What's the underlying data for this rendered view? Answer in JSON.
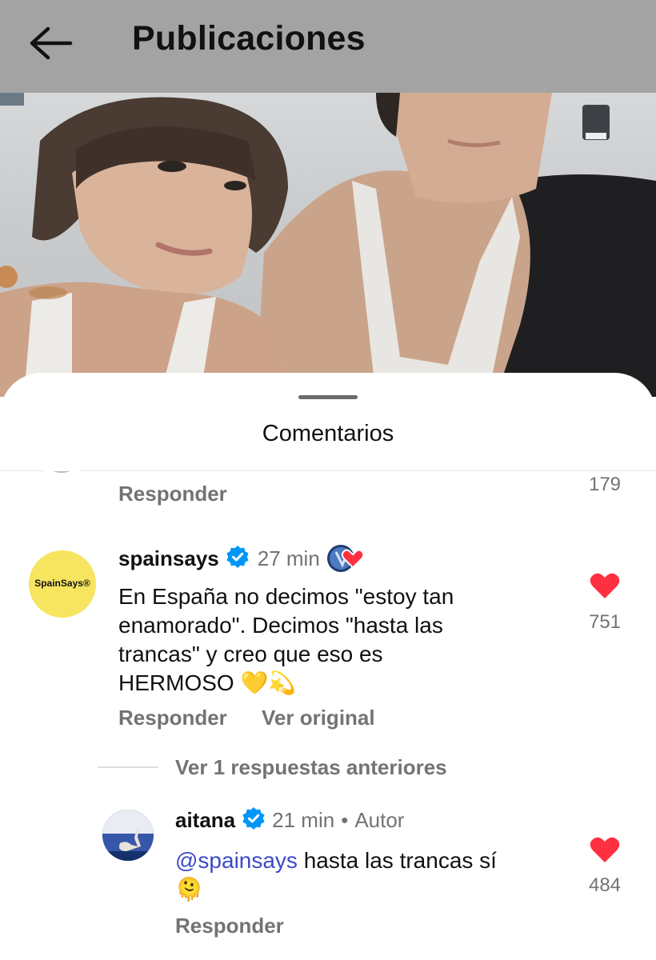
{
  "header": {
    "title": "Publicaciones",
    "back_icon": "arrow-left-icon"
  },
  "sheet": {
    "title": "Comentarios"
  },
  "comments": [
    {
      "reply_label": "Responder",
      "likes": "179"
    },
    {
      "username": "spainsays",
      "avatar_text": "SpainSays®",
      "verified": true,
      "time": "27 min",
      "text": "En España no decimos \"estoy tan enamorado\". Decimos \"hasta las trancas\" y creo que eso es HERMOSO 💛💫",
      "text_lines": [
        "En España no decimos \"estoy tan",
        "enamorado\". Decimos \"hasta las",
        "trancas\" y creo que eso es",
        "HERMOSO 💛💫"
      ],
      "reply_label": "Responder",
      "translate_label": "Ver original",
      "likes": "751",
      "liked": true
    }
  ],
  "replies_toggle": "Ver 1 respuestas anteriores",
  "reply": {
    "username": "aitana",
    "verified": true,
    "time": "21 min",
    "separator": "•",
    "author_label": "Autor",
    "mention": "@spainsays",
    "text": " hasta las trancas sí",
    "emoji": "🫠",
    "reply_label": "Responder",
    "likes": "484",
    "liked": true
  },
  "colors": {
    "accent_heart": "#ff3040",
    "verified": "#0095f6",
    "avatar_spainsays": "#f7e45f"
  }
}
